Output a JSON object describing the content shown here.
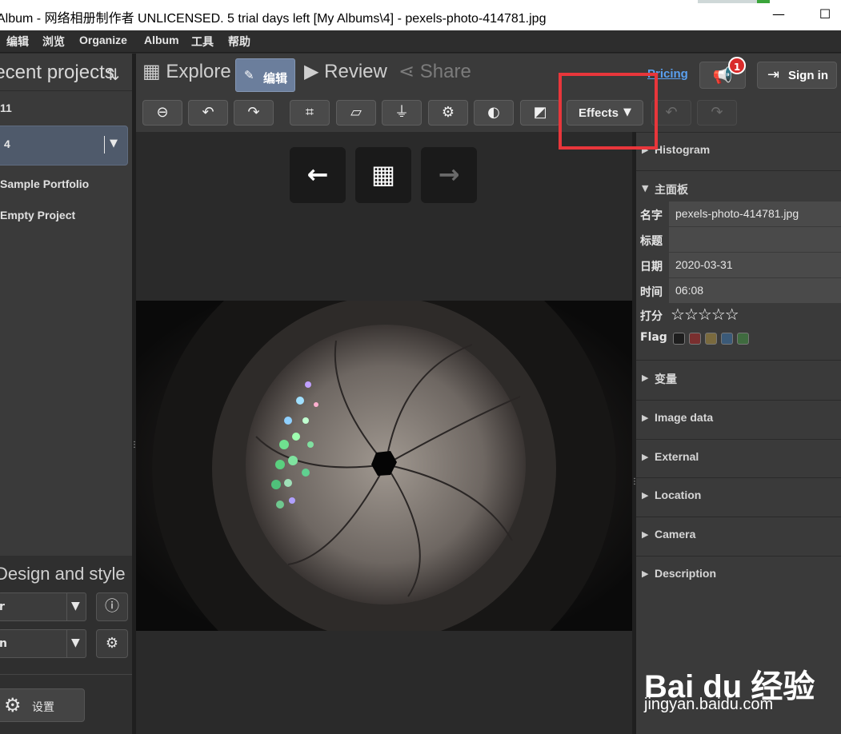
{
  "window": {
    "title": "Album - 网络相册制作者 UNLICENSED. 5 trial days left [My Albums\\4] - pexels-photo-414781.jpg",
    "minimize": "—",
    "maximize": "☐"
  },
  "menu": [
    "编辑",
    "浏览",
    "Organize",
    "Album",
    "工具",
    "帮助"
  ],
  "sidebar": {
    "header": "Recent projects",
    "year": "11",
    "selected_project": "4",
    "projects": [
      "Sample Portfolio",
      "Empty Project"
    ],
    "section2": "Design and style",
    "select1_value": "r",
    "select2_value": "n",
    "settings_label": "设置"
  },
  "nav": {
    "tabs": [
      {
        "label": "Explore",
        "icon": "grid-icon"
      },
      {
        "label": "编辑",
        "icon": "pencil-icon",
        "active": true
      },
      {
        "label": "Review",
        "icon": "play-icon"
      },
      {
        "label": "Share",
        "icon": "share-icon"
      }
    ],
    "pricing": "Pricing",
    "notification_count": "1",
    "sign_in": "Sign in"
  },
  "toolbar": {
    "buttons": [
      "remove-icon",
      "rotate-left-icon",
      "rotate-right-icon",
      "crop-icon",
      "perspective-icon",
      "straighten-icon",
      "settings-icon",
      "contrast-icon",
      "exposure-icon"
    ],
    "effects_label": "Effects",
    "undo": "undo-icon",
    "redo": "redo-icon",
    "highlight_color": "#e8363b"
  },
  "viewer": {
    "prev": "previous-icon",
    "grid": "grid-view-icon",
    "next": "next-icon",
    "image": "camera-lens-aperture-photo"
  },
  "panel": {
    "histogram": "Histogram",
    "main_panel": "主面板",
    "properties": [
      {
        "key": "名字",
        "value": "pexels-photo-414781.jpg"
      },
      {
        "key": "标题",
        "value": ""
      },
      {
        "key": "日期",
        "value": "2020-03-31"
      },
      {
        "key": "时间",
        "value": "06:08"
      }
    ],
    "rating_label": "打分",
    "rating": 0,
    "flag_label": "Flag",
    "flag_colors": [
      "#1e1e1e",
      "#7a2f2f",
      "#7a6a3e",
      "#3b5a78",
      "#3f6b3f"
    ],
    "sections": [
      "变量",
      "Image data",
      "External",
      "Location",
      "Camera",
      "Description"
    ]
  },
  "watermark": {
    "brand": "Bai du 经验",
    "url": "jingyan.baidu.com"
  }
}
